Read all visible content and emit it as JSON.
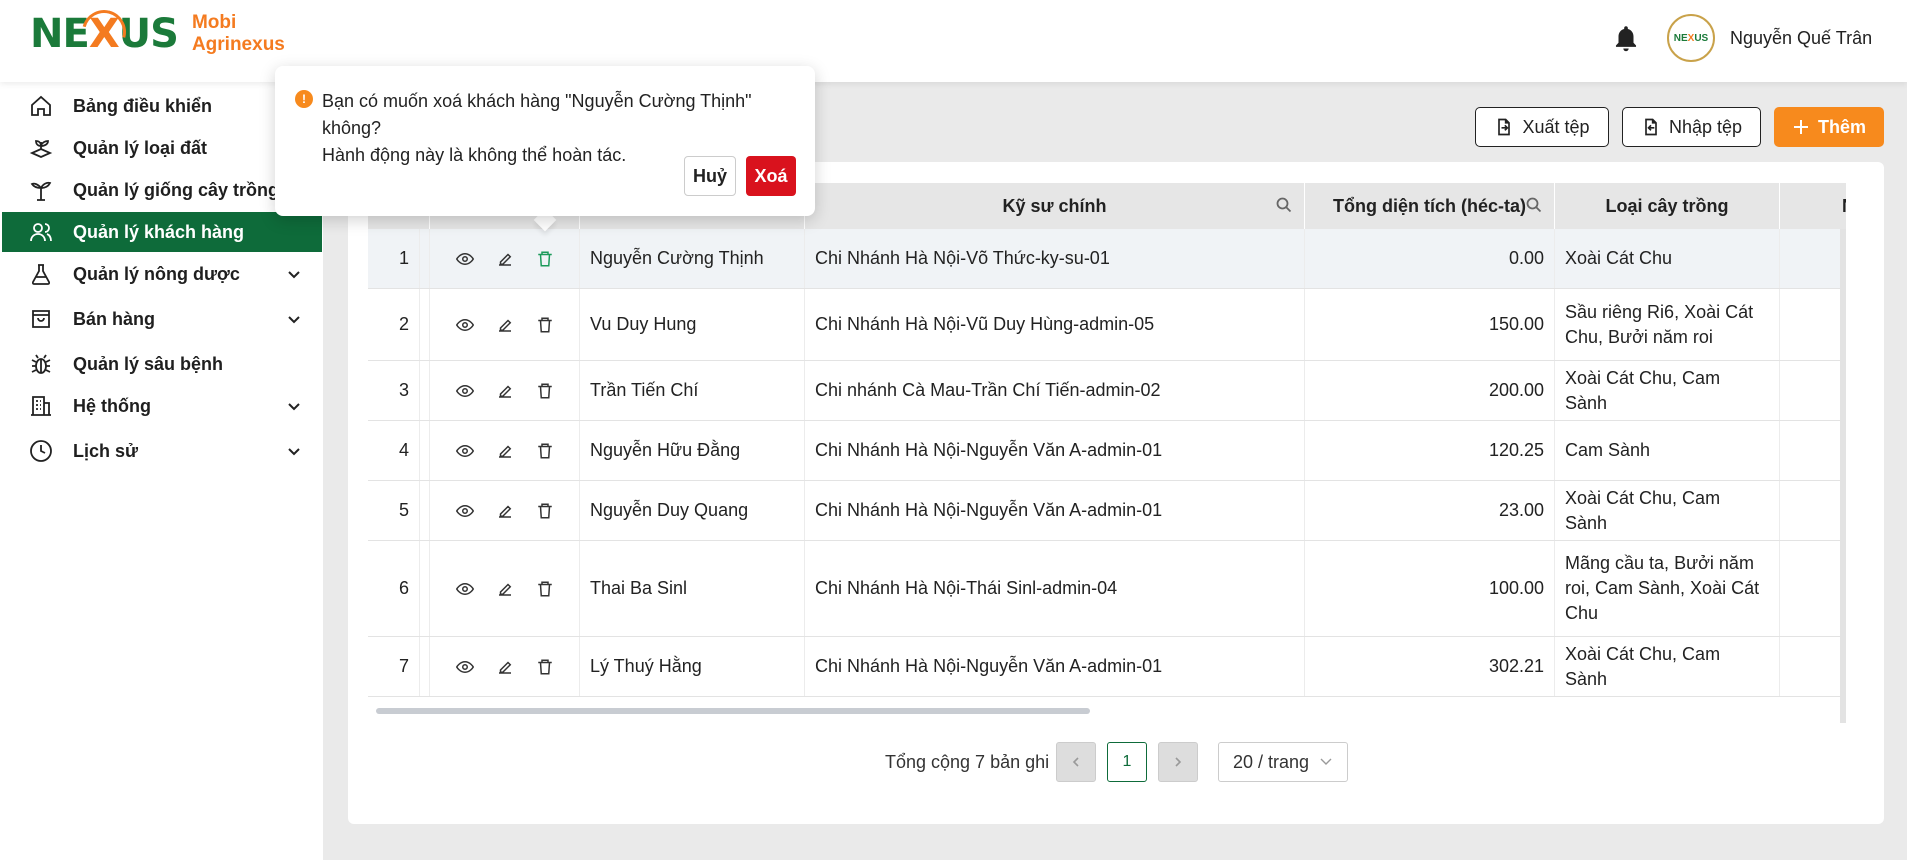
{
  "header": {
    "logo_mark_left": "NE",
    "logo_mark_x": "X",
    "logo_mark_right": "US",
    "logo_line1": "Mobi",
    "logo_line2": "Agrinexus",
    "avatar_left": "NE",
    "avatar_x": "X",
    "avatar_right": "US",
    "user_name": "Nguyễn Quế Trân"
  },
  "sidebar": {
    "items": [
      {
        "label": "Bảng điều khiển",
        "icon": "home-icon"
      },
      {
        "label": "Quản lý loại đất",
        "icon": "soil-icon"
      },
      {
        "label": "Quản lý giống cây trồng",
        "icon": "plant-icon"
      },
      {
        "label": "Quản lý khách hàng",
        "icon": "users-icon"
      },
      {
        "label": "Quản lý nông dược",
        "icon": "flask-icon"
      },
      {
        "label": "Bán hàng",
        "icon": "bag-icon"
      },
      {
        "label": "Quản lý sâu bệnh",
        "icon": "bug-icon"
      },
      {
        "label": "Hệ thống",
        "icon": "building-icon"
      },
      {
        "label": "Lịch sử",
        "icon": "clock-icon"
      }
    ],
    "active_index": 3
  },
  "toolbar": {
    "export_label": "Xuất tệp",
    "import_label": "Nhập tệp",
    "add_label": "Thêm"
  },
  "table": {
    "headers": {
      "engineer": "Kỹ sư chính",
      "area": "Tổng diện tích (héc-ta)",
      "crops": "Loại cây trồng",
      "next": "Ng"
    },
    "rows": [
      {
        "no": "1",
        "name": "Nguyễn Cường Thịnh",
        "engineer": "Chi Nhánh Hà Nội-Võ Thức-ky-su-01",
        "area": "0.00",
        "crops": "Xoài Cát Chu"
      },
      {
        "no": "2",
        "name": "Vu Duy Hung",
        "engineer": "Chi Nhánh Hà Nội-Vũ Duy Hùng-admin-05",
        "area": "150.00",
        "crops": "Sầu riêng Ri6, Xoài Cát Chu, Bưởi năm roi"
      },
      {
        "no": "3",
        "name": "Trần Tiến Chí",
        "engineer": "Chi nhánh Cà Mau-Trần Chí Tiến-admin-02",
        "area": "200.00",
        "crops": "Xoài Cát Chu, Cam Sành"
      },
      {
        "no": "4",
        "name": "Nguyễn Hữu Đằng",
        "engineer": "Chi Nhánh Hà Nội-Nguyễn Văn A-admin-01",
        "area": "120.25",
        "crops": "Cam Sành"
      },
      {
        "no": "5",
        "name": "Nguyễn Duy Quang",
        "engineer": "Chi Nhánh Hà Nội-Nguyễn Văn A-admin-01",
        "area": "23.00",
        "crops": "Xoài Cát Chu, Cam Sành"
      },
      {
        "no": "6",
        "name": "Thai Ba Sinl",
        "engineer": "Chi Nhánh Hà Nội-Thái Sinl-admin-04",
        "area": "100.00",
        "crops": "Mãng cầu ta, Bưởi năm roi, Cam Sành, Xoài Cát Chu"
      },
      {
        "no": "7",
        "name": "Lý Thuý Hằng",
        "engineer": "Chi Nhánh Hà Nội-Nguyễn Văn A-admin-01",
        "area": "302.21",
        "crops": "Xoài Cát Chu, Cam Sành"
      }
    ]
  },
  "pagination": {
    "total": "Tổng cộng 7 bản ghi",
    "current": "1",
    "page_size": "20 / trang"
  },
  "popconfirm": {
    "line1": "Bạn có muốn xoá khách hàng \"Nguyễn Cường Thịnh\" không?",
    "line2": "Hành động này là không thể hoàn tác.",
    "cancel": "Huỷ",
    "confirm": "Xoá"
  },
  "colors": {
    "brand_green": "#0e6b3a",
    "accent_orange": "#f78a1d",
    "danger_red": "#d9121d"
  }
}
